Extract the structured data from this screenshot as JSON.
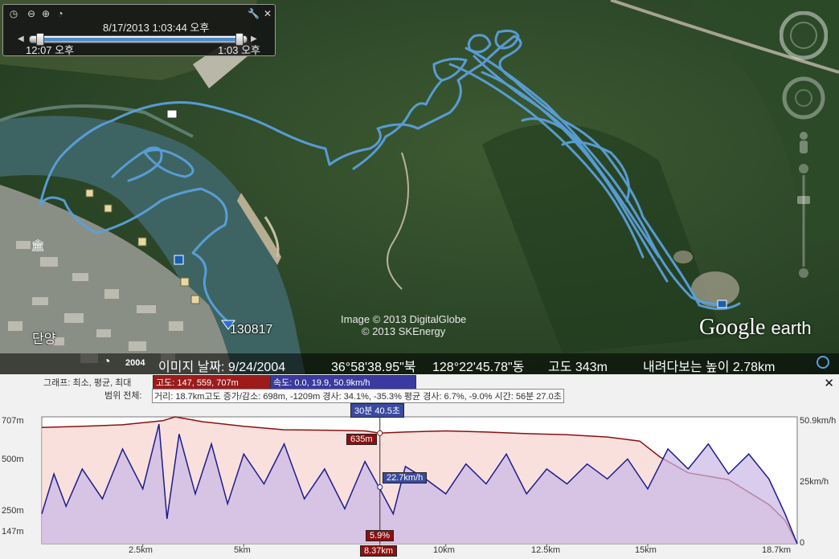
{
  "time_slider": {
    "date_time": "8/17/2013   1:03:44 오후",
    "start_time": "12:07 오후",
    "end_time": "1:03 오후",
    "progress": 1.0
  },
  "map": {
    "pin_label": "130817",
    "place_label": "단양",
    "attribution_line1": "Image © 2013 DigitalGlobe",
    "attribution_line2": "© 2013 SKEnergy",
    "logo_google": "Google",
    "logo_earth": "earth"
  },
  "status_bar": {
    "year": "2004",
    "image_date": "이미지 날짜: 9/24/2004",
    "lat": "36°58'38.95\"북",
    "lon": "128°22'45.78\"동",
    "altitude": "고도   343m",
    "eye_alt": "내려다보는 높이   2.78km"
  },
  "elevation_profile": {
    "graph_label": "그래프: 최소, 평균, 최대",
    "range_label": "범위 전체:",
    "alt_pill": "고도: 147, 559, 707m",
    "speed_pill": "속도: 0.0, 19.9, 50.9km/h",
    "stats": "거리: 18.7km고도 증가/감소: 698m, -1209m 경사: 34.1%, -35.3% 평균 경사: 6.7%, -9.0% 시간: 56분 27.0초",
    "time_marker": "30분 40.5초",
    "alt_marker": "635m",
    "speed_marker": "22.7km/h",
    "slope_marker": "5.9%",
    "distance_marker": "8.37km",
    "y_left_labels": [
      "707m",
      "500m",
      "250m",
      "147m"
    ],
    "y_right_labels": [
      "50.9km/h",
      "25km/h",
      "0"
    ],
    "x_labels": [
      "2.5km",
      "5km",
      "10km",
      "12.5km",
      "15km",
      "18.7km"
    ]
  },
  "chart_data": {
    "type": "area",
    "xlabel": "",
    "ylabel": "",
    "x_unit": "km",
    "xlim": [
      0,
      18.7
    ],
    "series": [
      {
        "name": "고도",
        "unit": "m",
        "ylim": [
          147,
          707
        ],
        "color": "#8b1010",
        "fill": "#f7d5d0",
        "x": [
          0,
          1.0,
          2.0,
          3.0,
          3.3,
          4.0,
          5.0,
          6.0,
          7.0,
          8.0,
          8.37,
          9.0,
          10.0,
          11.0,
          12.0,
          13.0,
          14.0,
          14.8,
          15.3,
          16.0,
          17.0,
          18.0,
          18.4,
          18.7
        ],
        "values": [
          660,
          665,
          672,
          690,
          707,
          685,
          665,
          650,
          648,
          645,
          635,
          640,
          645,
          640,
          633,
          628,
          618,
          600,
          530,
          460,
          430,
          320,
          250,
          147
        ]
      },
      {
        "name": "속도",
        "unit": "km/h",
        "ylim": [
          0,
          50.9
        ],
        "color": "#1c1c8c",
        "fill": "#c9b6e6",
        "x": [
          0,
          0.3,
          0.6,
          1.0,
          1.5,
          2.0,
          2.5,
          2.9,
          3.1,
          3.4,
          3.8,
          4.2,
          4.6,
          5.0,
          5.5,
          6.0,
          6.5,
          7.0,
          7.5,
          8.0,
          8.37,
          8.7,
          9.0,
          9.5,
          10.0,
          10.5,
          11.0,
          11.5,
          12.0,
          12.5,
          13.0,
          13.5,
          14.0,
          14.5,
          15.0,
          15.5,
          16.0,
          16.5,
          17.0,
          17.5,
          18.0,
          18.4,
          18.7
        ],
        "values": [
          12,
          28,
          15,
          30,
          18,
          38,
          22,
          48,
          10,
          44,
          20,
          40,
          16,
          36,
          24,
          40,
          18,
          30,
          14,
          33,
          22,
          12,
          31,
          26,
          20,
          32,
          24,
          36,
          20,
          30,
          24,
          32,
          26,
          34,
          22,
          38,
          30,
          40,
          28,
          36,
          26,
          12,
          0
        ]
      }
    ]
  },
  "colors": {
    "track": "#5aa0dc",
    "altitude_line": "#8b1010",
    "speed_line": "#1c1c8c",
    "marker_red": "#8b1010",
    "marker_blue": "#3a4aa0"
  }
}
